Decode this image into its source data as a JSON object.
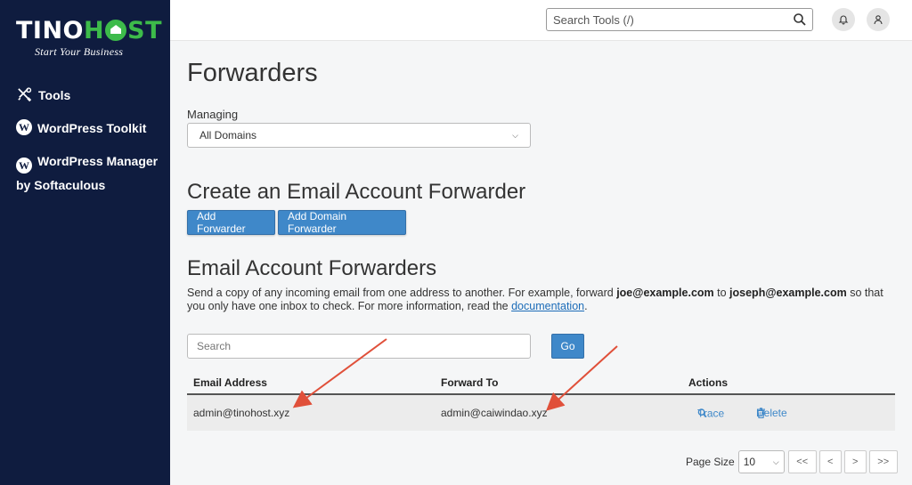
{
  "brand": {
    "logo_left": "TINO",
    "logo_right": "ST",
    "logo_h": "H",
    "tagline": "Start Your Business"
  },
  "sidebar": {
    "items": [
      {
        "label": "Tools",
        "icon": "tools-icon"
      },
      {
        "label": "WordPress Toolkit",
        "icon": "wordpress-icon"
      },
      {
        "label": "WordPress Manager by Softaculous",
        "icon": "wordpress-icon"
      }
    ]
  },
  "topbar": {
    "search_placeholder": "Search Tools (/)",
    "search_icon": "search-icon",
    "notifications_icon": "bell-icon",
    "user_icon": "user-icon"
  },
  "page": {
    "title": "Forwarders",
    "managing_label": "Managing",
    "managing_value": "All Domains",
    "create_heading": "Create an Email Account Forwarder",
    "add_forwarder": "Add Forwarder",
    "add_domain_forwarder": "Add Domain Forwarder",
    "list_heading": "Email Account Forwarders",
    "desc_1": "Send a copy of any incoming email from one address to another. For example, forward ",
    "desc_email_1": "joe@example.com",
    "desc_2": " to ",
    "desc_email_2": "joseph@example.com",
    "desc_3": " so that you only have one inbox to check. For more information, read the ",
    "desc_link": "documentation",
    "desc_4": ".",
    "search_placeholder": "Search",
    "go_label": "Go"
  },
  "table": {
    "columns": [
      "Email Address",
      "Forward To",
      "Actions"
    ],
    "rows": [
      {
        "email": "admin@tinohost.xyz",
        "forward_to": "admin@caiwindao.xyz",
        "trace": "Trace",
        "delete": "Delete"
      }
    ]
  },
  "pagination": {
    "page_size_label": "Page Size",
    "page_size_value": "10",
    "first": "<<",
    "prev": "<",
    "next": ">",
    "last": ">>"
  },
  "colors": {
    "sidebar_bg": "#0f1c3f",
    "brand_green": "#3dbb4a",
    "primary_button": "#3f88c9",
    "annotation_arrow": "#e0503a"
  }
}
